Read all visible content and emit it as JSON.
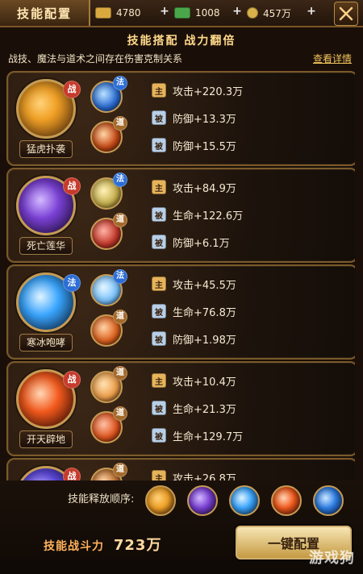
{
  "topbar": {
    "title": "技能配置",
    "resources": [
      {
        "icon": "gold-ingot-icon",
        "value": "4780",
        "color": "#d9a940"
      },
      {
        "icon": "cash-icon",
        "value": "1008",
        "color": "#4aa64a"
      },
      {
        "icon": "coin-icon",
        "value": "457万",
        "color": "#d7b14a"
      }
    ],
    "plus": "+",
    "close_icon": "crossed-swords-icon"
  },
  "header": {
    "title": "技能搭配 战力翻倍",
    "desc": "战技、魔法与道术之间存在伤害克制关系",
    "link": "查看详情"
  },
  "stat_labels": {
    "main": "主",
    "sub": "被"
  },
  "cards": [
    {
      "main_name": "猛虎扑袭",
      "main_badge": "战",
      "main_color": "#f1a126",
      "main_glow": "#6a3a10",
      "sub": [
        {
          "tag": "法",
          "color": "#2c6ed6"
        },
        {
          "tag": "道",
          "color": "#c84a15"
        }
      ],
      "stats": [
        "攻击+220.3万",
        "防御+13.3万",
        "防御+15.5万"
      ]
    },
    {
      "main_name": "死亡莲华",
      "main_badge": "战",
      "main_color": "#7b41d6",
      "main_glow": "#2a124b",
      "sub": [
        {
          "tag": "法",
          "color": "#c9b24f"
        },
        {
          "tag": "道",
          "color": "#c63b2c"
        }
      ],
      "stats": [
        "攻击+84.9万",
        "生命+122.6万",
        "防御+6.1万"
      ]
    },
    {
      "main_name": "寒冰咆哮",
      "main_badge": "法",
      "main_color": "#3aa6ff",
      "main_glow": "#0f2f55",
      "sub": [
        {
          "tag": "法",
          "color": "#7ec6ff"
        },
        {
          "tag": "道",
          "color": "#e2641f"
        }
      ],
      "stats": [
        "攻击+45.5万",
        "生命+76.8万",
        "防御+1.98万"
      ]
    },
    {
      "main_name": "开天辟地",
      "main_badge": "战",
      "main_color": "#f35a1d",
      "main_glow": "#4a1206",
      "sub": [
        {
          "tag": "道",
          "color": "#f0a04b"
        },
        {
          "tag": "道",
          "color": "#e1551d"
        }
      ],
      "stats": [
        "攻击+10.4万",
        "生命+21.3万",
        "生命+129.7万"
      ]
    },
    {
      "main_name": "",
      "main_badge": "战",
      "main_color": "#5d4adf",
      "main_glow": "#1e1440",
      "sub": [
        {
          "tag": "道",
          "color": "#b46a2a"
        }
      ],
      "stats": [
        "攻击+26.8万"
      ]
    }
  ],
  "bottom": {
    "order_label": "技能释放顺序:",
    "order_icons": [
      {
        "name": "tiger-strike-skill-icon",
        "color": "#f1a126"
      },
      {
        "name": "death-lotus-skill-icon",
        "color": "#7b41d6"
      },
      {
        "name": "ice-roar-skill-icon",
        "color": "#3aa6ff"
      },
      {
        "name": "fire-slash-skill-icon",
        "color": "#f35a1d"
      },
      {
        "name": "blue-orb-skill-icon",
        "color": "#2d7fe6"
      }
    ],
    "power_label": "技能战斗力",
    "power_value": "723万",
    "one_key": "一键配置",
    "watermark": "游戏狗"
  }
}
